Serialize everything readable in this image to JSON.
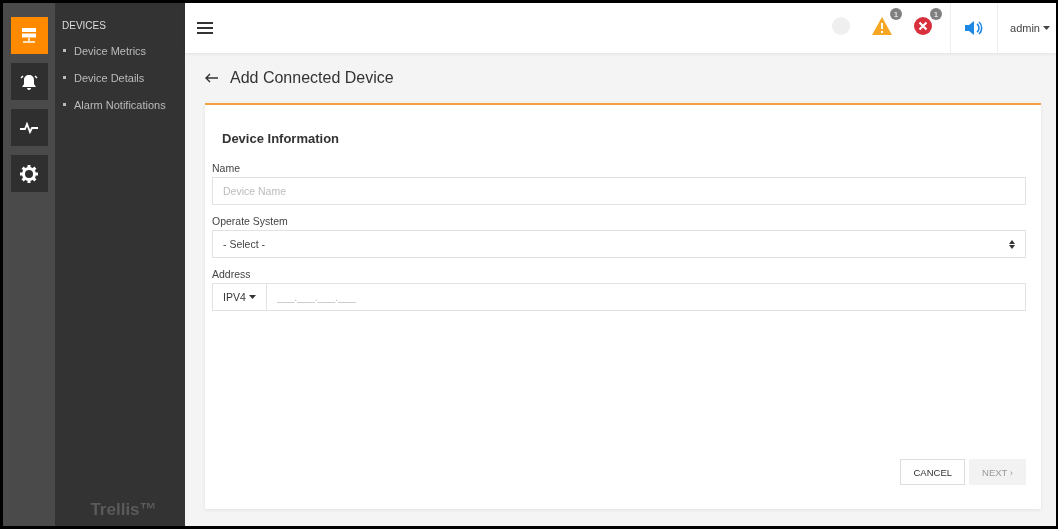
{
  "rail": [
    {
      "kind": "server",
      "selected": true
    },
    {
      "kind": "bell",
      "selected": false
    },
    {
      "kind": "pulse",
      "selected": false
    },
    {
      "kind": "gear",
      "selected": false
    }
  ],
  "sidebar": {
    "heading": "DEVICES",
    "items": [
      {
        "label": "Device Metrics"
      },
      {
        "label": "Device Details"
      },
      {
        "label": "Alarm Notifications"
      }
    ],
    "logo": "Trellis™"
  },
  "topbar": {
    "alerts": [
      {
        "kind": "info"
      },
      {
        "kind": "warning",
        "count": "1"
      },
      {
        "kind": "error",
        "count": "1"
      }
    ],
    "user": "admin"
  },
  "page": {
    "title": "Add Connected Device"
  },
  "form": {
    "section": "Device Information",
    "fields": [
      {
        "kind": "text",
        "label": "Name",
        "placeholder": "Device Name"
      },
      {
        "kind": "select",
        "label": "Operate System",
        "value": "- Select -"
      },
      {
        "kind": "address",
        "label": "Address",
        "prefix": "IPV4",
        "placeholder": "___.___.___.___"
      }
    ],
    "buttons": [
      {
        "label": "CANCEL",
        "disabled": false
      },
      {
        "label": "NEXT ›",
        "disabled": true
      }
    ]
  }
}
